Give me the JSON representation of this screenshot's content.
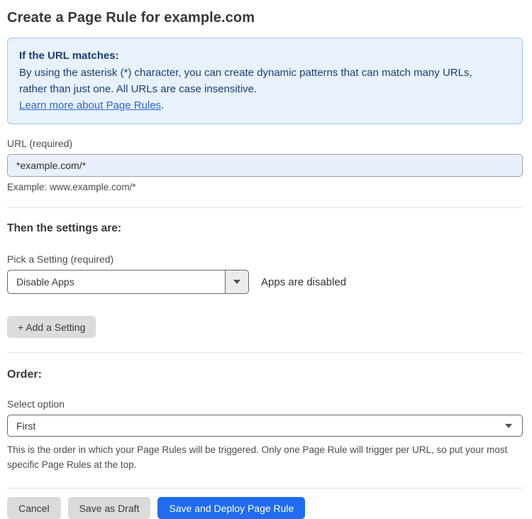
{
  "page": {
    "title": "Create a Page Rule for example.com"
  },
  "info_box": {
    "heading": "If the URL matches:",
    "body": "By using the asterisk (*) character, you can create dynamic patterns that can match many URLs, rather than just one. All URLs are case insensitive.",
    "link_label": "Learn more about Page Rules",
    "link_suffix": "."
  },
  "url_field": {
    "label": "URL (required)",
    "value": "*example.com/*",
    "helper": "Example: www.example.com/*"
  },
  "settings_section": {
    "heading": "Then the settings are:",
    "setting_label": "Pick a Setting (required)",
    "setting_value": "Disable Apps",
    "setting_status": "Apps are disabled",
    "add_setting_label": "+ Add a Setting"
  },
  "order_section": {
    "heading": "Order:",
    "select_label": "Select option",
    "select_value": "First",
    "helper": "This is the order in which your Page Rules will be triggered. Only one Page Rule will trigger per URL, so put your most specific Page Rules at the top."
  },
  "footer": {
    "cancel_label": "Cancel",
    "save_draft_label": "Save as Draft",
    "save_deploy_label": "Save and Deploy Page Rule"
  },
  "colors": {
    "accent_blue": "#1f6cf0",
    "info_box_bg": "#e8f1fc",
    "info_box_border": "#a6c8ee",
    "info_text": "#1b3f77",
    "link_blue": "#2c67d6",
    "url_input_bg": "#e9f0fb",
    "gray_button_bg": "#dbdbdb"
  }
}
